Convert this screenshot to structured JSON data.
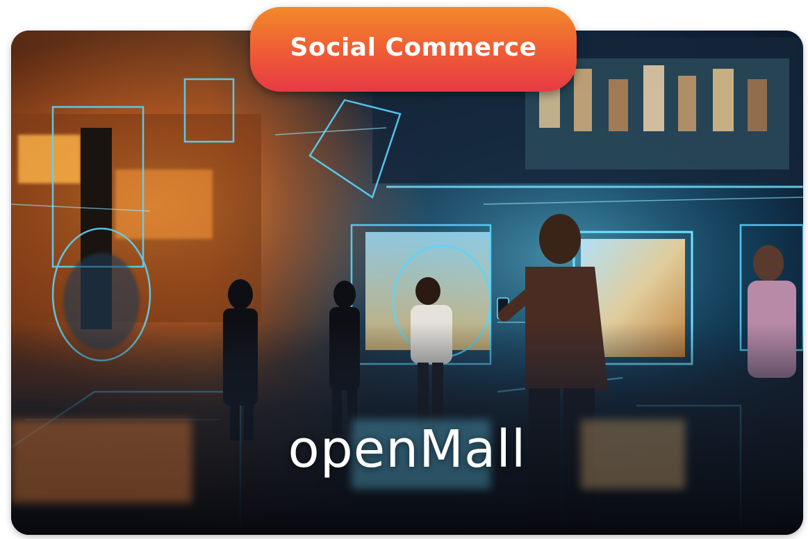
{
  "badge": {
    "label": "Social Commerce",
    "gradient_top": "#f28a2a",
    "gradient_bottom": "#e83a45"
  },
  "card": {
    "title": "openMall",
    "image": "futuristic-holographic-mall-image"
  },
  "colors": {
    "hologram_cyan": "#39d2ff",
    "warm_glow": "#ff8a2b",
    "background_dark": "#0b1322"
  }
}
